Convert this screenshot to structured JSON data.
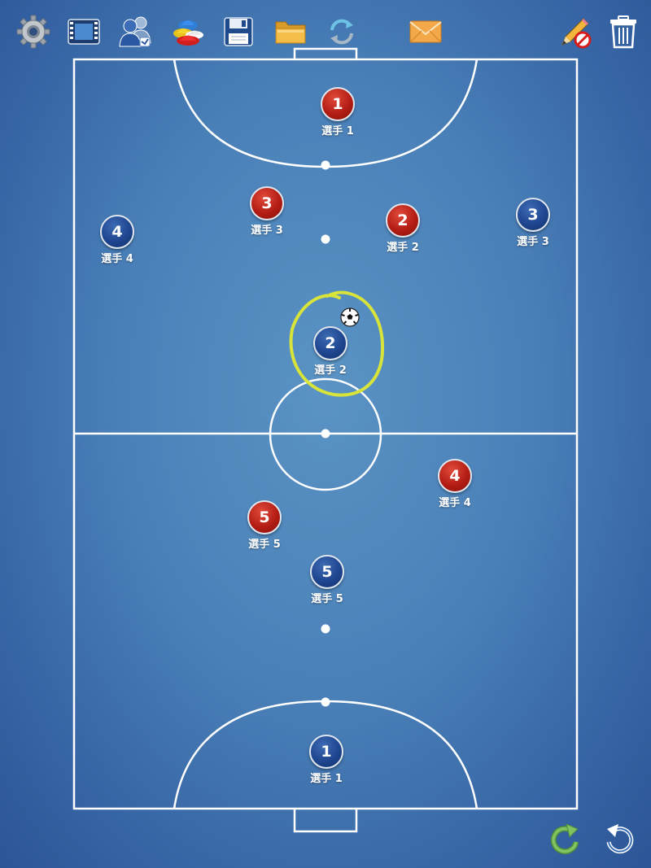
{
  "toolbar": {
    "items": [
      {
        "name": "settings",
        "icon": "gear-icon"
      },
      {
        "name": "animation",
        "icon": "film-icon"
      },
      {
        "name": "teams",
        "icon": "players-icon"
      },
      {
        "name": "equipment",
        "icon": "cones-icon"
      },
      {
        "name": "save",
        "icon": "floppy-disk-icon"
      },
      {
        "name": "open",
        "icon": "folder-icon"
      },
      {
        "name": "swap",
        "icon": "sync-arrows-icon"
      },
      {
        "name": "email",
        "icon": "envelope-icon"
      },
      {
        "name": "draw",
        "icon": "pencil-icon"
      },
      {
        "name": "delete",
        "icon": "trash-icon"
      }
    ]
  },
  "bottom_controls": {
    "redo_icon": "redo-icon",
    "undo_icon": "undo-icon"
  },
  "colors": {
    "red_team": "#b41d14",
    "blue_team": "#1f4690",
    "field_lines": "#ffffff",
    "annotation": "#d8e43a"
  },
  "players": [
    {
      "team": "red",
      "number": "1",
      "name": "選手 1"
    },
    {
      "team": "red",
      "number": "3",
      "name": "選手 3"
    },
    {
      "team": "red",
      "number": "2",
      "name": "選手 2"
    },
    {
      "team": "blue",
      "number": "3",
      "name": "選手 3"
    },
    {
      "team": "blue",
      "number": "4",
      "name": "選手 4"
    },
    {
      "team": "blue",
      "number": "2",
      "name": "選手 2"
    },
    {
      "team": "red",
      "number": "4",
      "name": "選手 4"
    },
    {
      "team": "red",
      "number": "5",
      "name": "選手 5"
    },
    {
      "team": "blue",
      "number": "5",
      "name": "選手 5"
    },
    {
      "team": "blue",
      "number": "1",
      "name": "選手 1"
    }
  ],
  "ball": {
    "icon": "soccer-ball-icon"
  },
  "annotation": {
    "shape": "freehand-circle",
    "icon": "highlight-circle"
  }
}
